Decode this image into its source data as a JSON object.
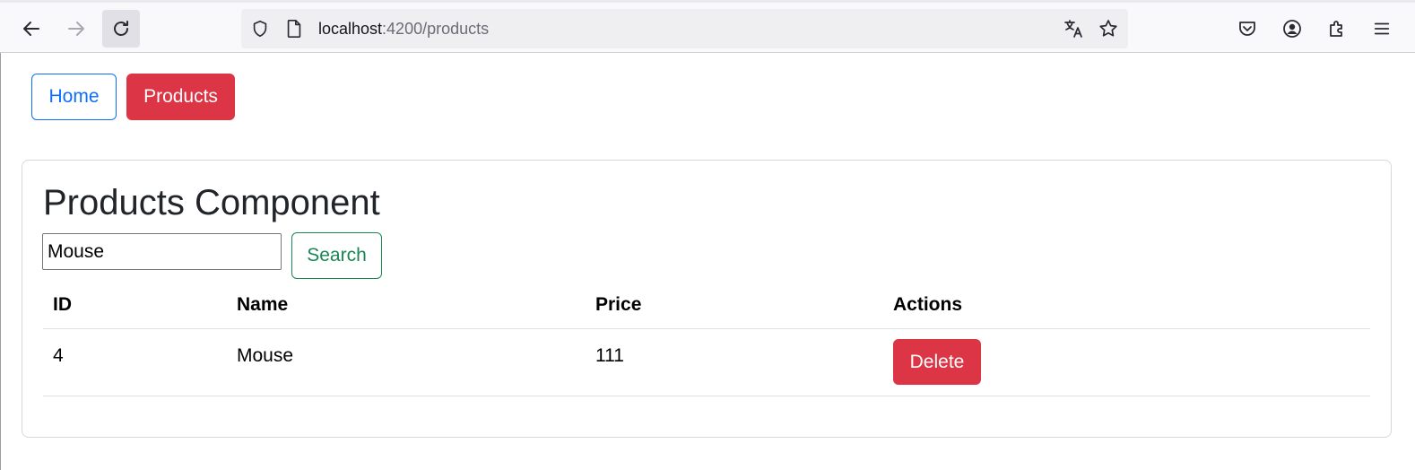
{
  "browser": {
    "url_host": "localhost",
    "url_path": ":4200/products",
    "icons": {
      "back": "back-arrow-icon",
      "forward": "forward-arrow-icon",
      "reload": "reload-icon",
      "shield": "shield-icon",
      "page": "page-icon",
      "translate": "translate-icon",
      "bookmark": "star-icon",
      "pocket": "pocket-icon",
      "account": "account-icon",
      "extensions": "extensions-icon",
      "menu": "hamburger-menu-icon"
    }
  },
  "nav": {
    "home_label": "Home",
    "products_label": "Products"
  },
  "main": {
    "title": "Products Component",
    "search": {
      "value": "Mouse",
      "button_label": "Search"
    },
    "table": {
      "headers": [
        "ID",
        "Name",
        "Price",
        "Actions"
      ],
      "rows": [
        {
          "id": "4",
          "name": "Mouse",
          "price": "111",
          "action_label": "Delete"
        }
      ]
    }
  },
  "colors": {
    "primary": "#0d6efd",
    "danger": "#dc3545",
    "success": "#198754"
  }
}
